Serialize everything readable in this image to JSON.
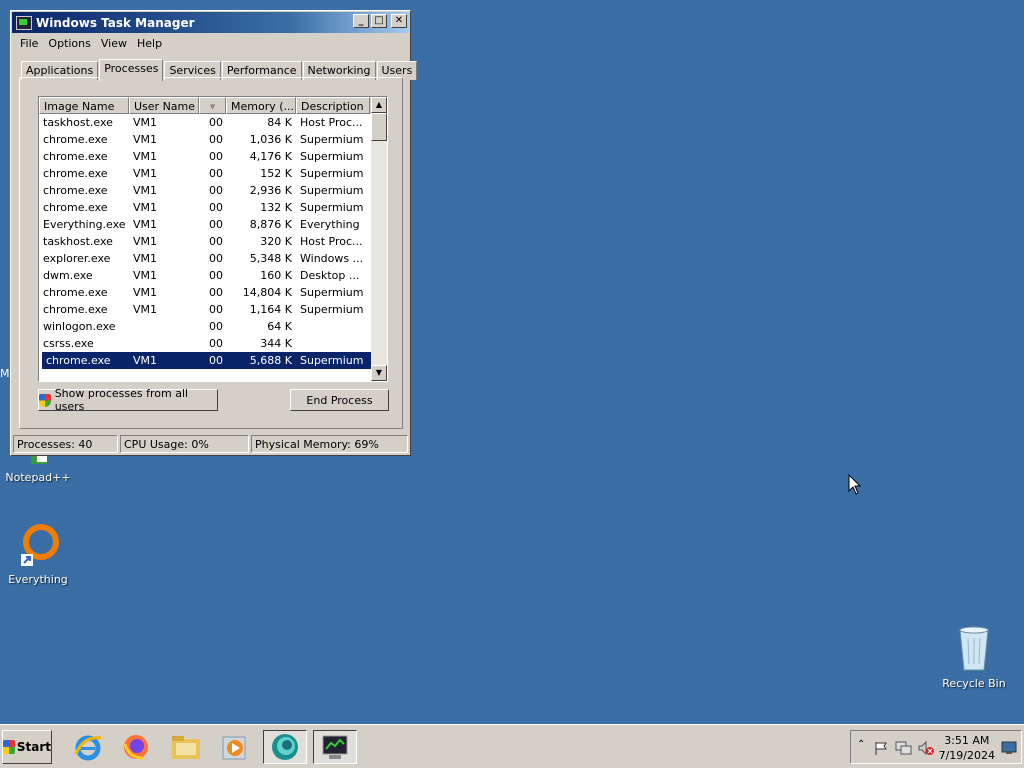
{
  "window": {
    "title": "Windows Task Manager",
    "controls": {
      "minimize": "_",
      "maximize": "□",
      "close": "✕"
    },
    "menu": [
      "File",
      "Options",
      "View",
      "Help"
    ],
    "tabs": [
      "Applications",
      "Processes",
      "Services",
      "Performance",
      "Networking",
      "Users"
    ],
    "active_tab": "Processes",
    "columns": [
      "Image Name",
      "User Name",
      "",
      "Memory (...",
      "Description"
    ],
    "rows": [
      {
        "image": "taskhost.exe",
        "user": "VM1",
        "cpu": "00",
        "mem": "84 K",
        "desc": "Host Proc..."
      },
      {
        "image": "chrome.exe",
        "user": "VM1",
        "cpu": "00",
        "mem": "1,036 K",
        "desc": "Supermium"
      },
      {
        "image": "chrome.exe",
        "user": "VM1",
        "cpu": "00",
        "mem": "4,176 K",
        "desc": "Supermium"
      },
      {
        "image": "chrome.exe",
        "user": "VM1",
        "cpu": "00",
        "mem": "152 K",
        "desc": "Supermium"
      },
      {
        "image": "chrome.exe",
        "user": "VM1",
        "cpu": "00",
        "mem": "2,936 K",
        "desc": "Supermium"
      },
      {
        "image": "chrome.exe",
        "user": "VM1",
        "cpu": "00",
        "mem": "132 K",
        "desc": "Supermium"
      },
      {
        "image": "Everything.exe",
        "user": "VM1",
        "cpu": "00",
        "mem": "8,876 K",
        "desc": "Everything"
      },
      {
        "image": "taskhost.exe",
        "user": "VM1",
        "cpu": "00",
        "mem": "320 K",
        "desc": "Host Proc..."
      },
      {
        "image": "explorer.exe",
        "user": "VM1",
        "cpu": "00",
        "mem": "5,348 K",
        "desc": "Windows ..."
      },
      {
        "image": "dwm.exe",
        "user": "VM1",
        "cpu": "00",
        "mem": "160 K",
        "desc": "Desktop ..."
      },
      {
        "image": "chrome.exe",
        "user": "VM1",
        "cpu": "00",
        "mem": "14,804 K",
        "desc": "Supermium"
      },
      {
        "image": "chrome.exe",
        "user": "VM1",
        "cpu": "00",
        "mem": "1,164 K",
        "desc": "Supermium"
      },
      {
        "image": "winlogon.exe",
        "user": "",
        "cpu": "00",
        "mem": "64 K",
        "desc": ""
      },
      {
        "image": "csrss.exe",
        "user": "",
        "cpu": "00",
        "mem": "344 K",
        "desc": ""
      },
      {
        "image": "chrome.exe",
        "user": "VM1",
        "cpu": "00",
        "mem": "5,688 K",
        "desc": "Supermium",
        "selected": true
      }
    ],
    "show_all_label": "Show processes from all users",
    "end_process_label": "End Process",
    "status": {
      "processes": "Processes: 40",
      "cpu": "CPU Usage: 0%",
      "memory": "Physical Memory: 69%"
    }
  },
  "desktop": {
    "icons": [
      {
        "label": "Notepad++",
        "icon": "notepad-plus-plus-icon"
      },
      {
        "label": "Everything",
        "icon": "everything-icon"
      },
      {
        "label": "Recycle Bin",
        "icon": "recycle-bin-icon"
      }
    ],
    "edge_letter": "M"
  },
  "taskbar": {
    "start_label": "Start",
    "apps": [
      "internet-explorer-icon",
      "firefox-icon",
      "file-explorer-icon",
      "media-player-icon",
      "supermium-icon",
      "task-manager-icon"
    ],
    "clock_time": "3:51 AM",
    "clock_date": "7/19/2024",
    "tray_icons": [
      "chevron-up-icon",
      "action-center-flag-icon",
      "network-icon",
      "volume-muted-icon",
      "show-desktop-icon"
    ]
  },
  "colors": {
    "desktop": "#3a6ea5",
    "selection": "#0a246a",
    "titlebar": "#0a246a"
  }
}
